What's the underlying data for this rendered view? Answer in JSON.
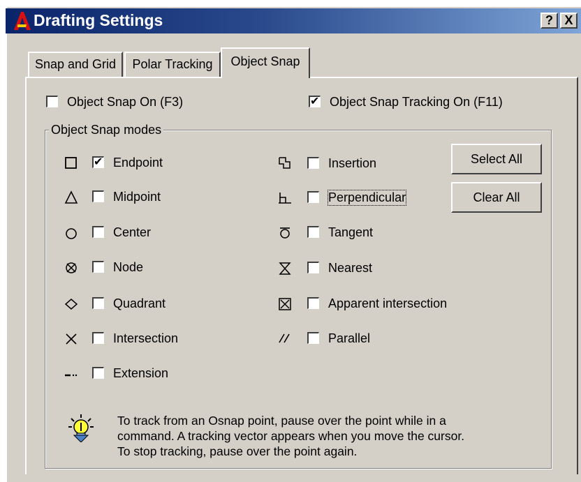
{
  "window": {
    "title": "Drafting Settings",
    "help_label": "?",
    "close_label": "X"
  },
  "tabs": [
    {
      "label": "Snap and Grid"
    },
    {
      "label": "Polar Tracking"
    },
    {
      "label": "Object Snap"
    }
  ],
  "options": {
    "object_snap_on": {
      "label": "Object Snap On (F3)",
      "checked": false
    },
    "object_snap_tracking_on": {
      "label": "Object Snap Tracking On (F11)",
      "checked": true
    }
  },
  "modes": {
    "group_title": "Object Snap modes",
    "left": [
      {
        "label": "Endpoint",
        "checked": true,
        "icon": "endpoint-square-icon"
      },
      {
        "label": "Midpoint",
        "checked": false,
        "icon": "midpoint-triangle-icon"
      },
      {
        "label": "Center",
        "checked": false,
        "icon": "center-circle-icon"
      },
      {
        "label": "Node",
        "checked": false,
        "icon": "node-icon"
      },
      {
        "label": "Quadrant",
        "checked": false,
        "icon": "quadrant-diamond-icon"
      },
      {
        "label": "Intersection",
        "checked": false,
        "icon": "intersection-x-icon"
      },
      {
        "label": "Extension",
        "checked": false,
        "icon": "extension-icon"
      }
    ],
    "right": [
      {
        "label": "Insertion",
        "checked": false,
        "icon": "insertion-icon"
      },
      {
        "label": "Perpendicular",
        "checked": false,
        "icon": "perpendicular-icon"
      },
      {
        "label": "Tangent",
        "checked": false,
        "icon": "tangent-icon"
      },
      {
        "label": "Nearest",
        "checked": false,
        "icon": "nearest-icon"
      },
      {
        "label": "Apparent intersection",
        "checked": false,
        "icon": "apparent-intersection-icon"
      },
      {
        "label": "Parallel",
        "checked": false,
        "icon": "parallel-icon"
      }
    ]
  },
  "buttons": {
    "select_all": "Select All",
    "clear_all": "Clear All"
  },
  "hint": {
    "lines": [
      "To track from an Osnap point, pause over the point while in a",
      "command.  A tracking vector appears when you move the cursor.",
      "To stop tracking, pause over the point again."
    ],
    "icon": "lightbulb-icon"
  }
}
